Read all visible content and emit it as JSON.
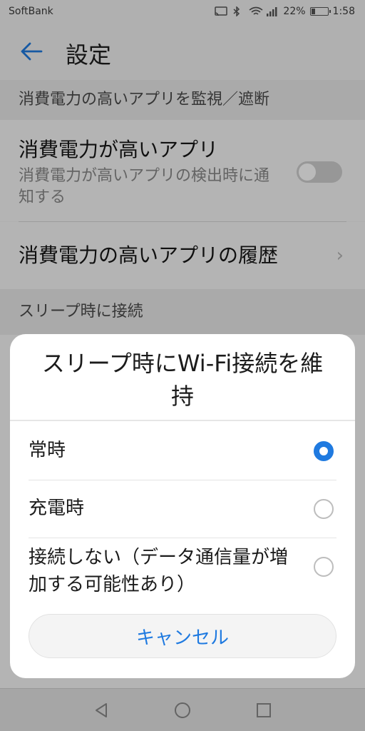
{
  "status": {
    "carrier": "SoftBank",
    "battery_percent": 22,
    "battery_text": "22%",
    "time": "1:58"
  },
  "header": {
    "back_icon": "arrow-left-icon",
    "title": "設定"
  },
  "sections": [
    {
      "label": "消費電力の高いアプリを監視／遮断"
    },
    {
      "label": "スリープ時に接続"
    }
  ],
  "rows": [
    {
      "title": "消費電力が高いアプリ",
      "subtitle": "消費電力が高いアプリの検出時に通知する",
      "toggle_on": false
    },
    {
      "title": "消費電力の高いアプリの履歴"
    }
  ],
  "dialog": {
    "title": "スリープ時にWi-Fi接続を維持",
    "options": [
      {
        "label": "常時",
        "selected": true
      },
      {
        "label": "充電時",
        "selected": false
      },
      {
        "label": "接続しない（データ通信量が増加する可能性あり）",
        "selected": false
      }
    ],
    "cancel_label": "キャンセル"
  },
  "colors": {
    "accent": "#1f7ae0"
  },
  "navbar": {
    "icons": [
      "back-triangle-icon",
      "home-circle-icon",
      "recents-square-icon"
    ]
  }
}
